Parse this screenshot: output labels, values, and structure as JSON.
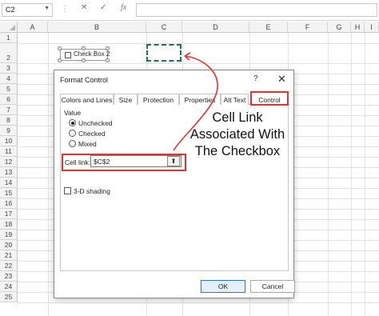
{
  "formula_bar": {
    "name_box": "C2",
    "sep_glyph": "⋮",
    "cancel_glyph": "✕",
    "enter_glyph": "✓",
    "fx_label": "fx",
    "formula": ""
  },
  "columns": [
    "A",
    "B",
    "C",
    "D",
    "E",
    "F",
    "G",
    "H",
    "I"
  ],
  "rows": [
    "1",
    "2",
    "3",
    "4",
    "5",
    "6",
    "7",
    "8",
    "9",
    "10",
    "11",
    "12",
    "13",
    "14",
    "15",
    "16",
    "17",
    "18",
    "19",
    "20",
    "21",
    "22",
    "23",
    "24",
    "25"
  ],
  "sheet": {
    "checkbox_label": "Check Box 2"
  },
  "dialog": {
    "title": "Format Control",
    "help_glyph": "?",
    "close_glyph": "✕",
    "tabs": [
      "Colors and Lines",
      "Size",
      "Protection",
      "Properties",
      "Alt Text",
      "Control"
    ],
    "active_tab": "Control",
    "value_group": "Value",
    "radios": [
      "Unchecked",
      "Checked",
      "Mixed"
    ],
    "selected_radio": "Unchecked",
    "cell_link_label": "Cell link:",
    "cell_link_value": "$C$2",
    "collapse_glyph": "⬆",
    "shading_label": "3-D shading",
    "ok_label": "OK",
    "cancel_label": "Cancel"
  },
  "annotation": {
    "lines": [
      "Cell Link",
      "Associated With",
      "The Checkbox"
    ]
  },
  "colors": {
    "highlight": "#e03434",
    "selection": "#217346"
  }
}
